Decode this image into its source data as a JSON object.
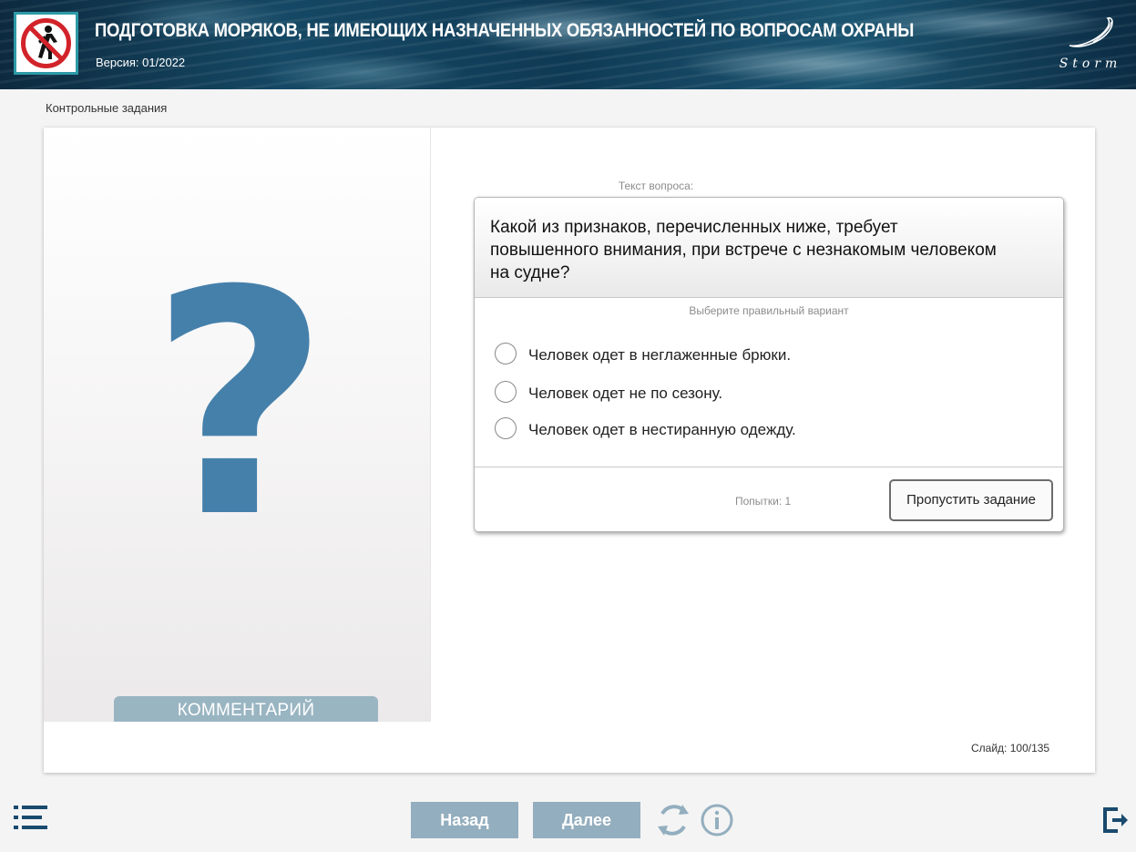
{
  "header": {
    "title": "ПОДГОТОВКА МОРЯКОВ, НЕ ИМЕЮЩИХ НАЗНАЧЕННЫХ ОБЯЗАННОСТЕЙ ПО ВОПРОСАМ ОХРАНЫ",
    "version": "Версия: 01/2022",
    "logo_icon": "no-pedestrian-sign-icon",
    "brand_logo_text": "Storm",
    "logo_accent_color": "#2d9aa7"
  },
  "breadcrumb": "Контрольные задания",
  "left_panel": {
    "placeholder_symbol": "?",
    "comment_button": "КОММЕНТАРИЙ",
    "accent_color": "#4580ab"
  },
  "question": {
    "label": "Текст вопроса:",
    "text": "Какой из признаков, перечисленных ниже, требует повышенного внимания, при встрече с незнакомым человеком на судне?",
    "instruction": "Выберите правильный вариант",
    "options": [
      "Человек одет в неглаженные брюки.",
      "Человек одет не по сезону.",
      "Человек одет в нестиранную одежду."
    ],
    "attempts": "Попытки: 1",
    "skip_button": "Пропустить задание"
  },
  "slide_counter": "Слайд:  100/135",
  "nav": {
    "back": "Назад",
    "next": "Далее",
    "button_color": "#93aebe",
    "icons": [
      "menu-list-icon",
      "reload-icon",
      "info-icon",
      "exit-icon"
    ]
  }
}
